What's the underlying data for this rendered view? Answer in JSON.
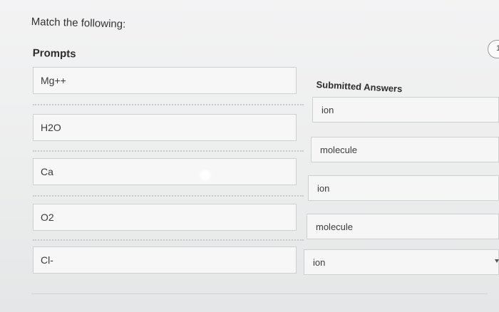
{
  "question": {
    "text": "Match the following:"
  },
  "prompts": {
    "heading": "Prompts",
    "items": [
      {
        "label": "Mg++"
      },
      {
        "label": "H2O"
      },
      {
        "label": "Ca"
      },
      {
        "label": "O2"
      },
      {
        "label": "Cl-"
      }
    ]
  },
  "answers": {
    "heading": "Submitted Answers",
    "items": [
      {
        "value": "ion"
      },
      {
        "value": "molecule"
      },
      {
        "value": "ion"
      },
      {
        "value": "molecule"
      },
      {
        "value": "ion"
      }
    ]
  },
  "badge": {
    "text": "1"
  }
}
